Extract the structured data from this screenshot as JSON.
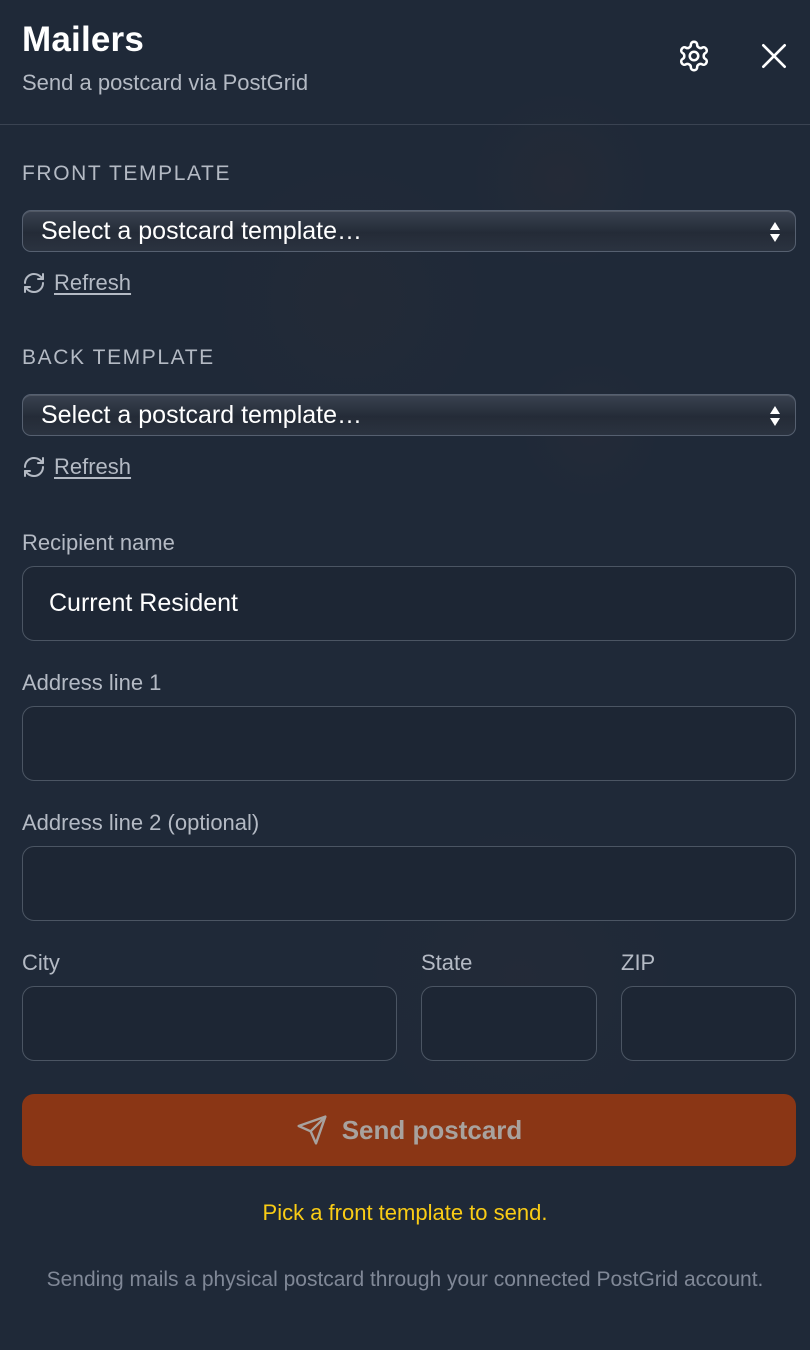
{
  "header": {
    "title": "Mailers",
    "subtitle": "Send a postcard via PostGrid"
  },
  "front_template": {
    "label": "FRONT TEMPLATE",
    "selected": "Select a postcard template…",
    "refresh_label": "Refresh"
  },
  "back_template": {
    "label": "BACK TEMPLATE",
    "selected": "Select a postcard template…",
    "refresh_label": "Refresh"
  },
  "recipient": {
    "name_label": "Recipient name",
    "name_value": "Current Resident",
    "address1_label": "Address line 1",
    "address1_value": "",
    "address2_label": "Address line 2 (optional)",
    "address2_value": "",
    "city_label": "City",
    "city_value": "",
    "state_label": "State",
    "state_value": "",
    "zip_label": "ZIP",
    "zip_value": ""
  },
  "actions": {
    "send_label": "Send postcard"
  },
  "status": {
    "warning": "Pick a front template to send.",
    "note": "Sending mails a physical postcard through your connected PostGrid account."
  },
  "icons": {
    "settings": "gear-icon",
    "close": "close-icon",
    "refresh": "refresh-icon",
    "send": "paper-plane-icon"
  },
  "colors": {
    "background": "#1f2938",
    "accent_button": "#8a3615",
    "warning": "#facc15"
  }
}
